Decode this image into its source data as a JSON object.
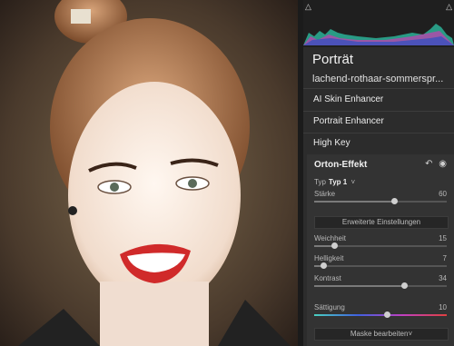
{
  "panel": {
    "title": "Porträt",
    "preset_name": "lachend-rothaar-sommerspr...",
    "items": [
      {
        "label": "AI Skin Enhancer"
      },
      {
        "label": "Portrait Enhancer"
      },
      {
        "label": "High Key"
      }
    ]
  },
  "orton": {
    "title": "Orton-Effekt",
    "reset_icon": "reset-icon",
    "eye_icon": "eye-icon",
    "typ_label": "Typ",
    "typ_value": "Typ 1",
    "typ_arrow": "˅",
    "staerke": {
      "label": "Stärke",
      "value": "60",
      "level": 0.6
    },
    "advanced_button": "Erweiterte Einstellungen",
    "weichheit": {
      "label": "Weichheit",
      "value": "15",
      "level": 0.15
    },
    "helligkeit": {
      "label": "Helligkeit",
      "value": "7",
      "level": 0.07
    },
    "kontrast": {
      "label": "Kontrast",
      "value": "34",
      "level": 0.68
    },
    "saettigung": {
      "label": "Sättigung",
      "value": "10",
      "level": 0.55
    },
    "mask_button": "Maske bearbeiten˅"
  },
  "colors": {
    "accent": "#8ad0c8",
    "saturation_gradient": [
      "#4ad0c0",
      "#4060e0",
      "#c040c0",
      "#e04040"
    ]
  }
}
